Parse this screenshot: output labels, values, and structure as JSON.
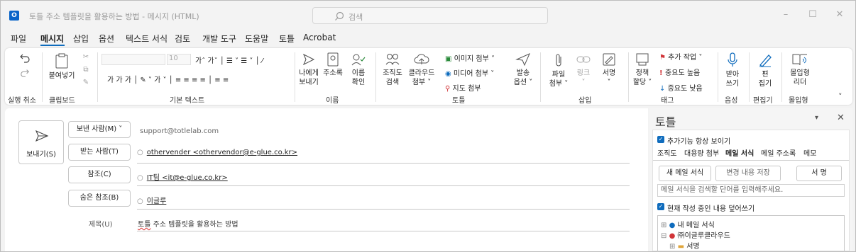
{
  "window": {
    "title": "토틀 주소 템플릿을 활용하는 방법 - 메시지 (HTML)",
    "search_placeholder": "검색",
    "app_icon": "outlook-icon",
    "minimize": "–",
    "maximize": "☐",
    "close": "✕"
  },
  "menu": {
    "tabs": [
      "파일",
      "메시지",
      "삽입",
      "옵션",
      "텍스트 서식",
      "검토",
      "개발 도구",
      "도움말",
      "토틀",
      "Acrobat"
    ],
    "active": "메시지"
  },
  "ribbon": {
    "undo": {
      "group": "실행 취소"
    },
    "clipboard": {
      "paste": "붙여넣기",
      "group": "클립보드"
    },
    "basic_text": {
      "font_size": "10",
      "group": "기본 텍스트"
    },
    "names": {
      "address_book": "주소록",
      "to_me_1": "나에게",
      "to_me_2": "보내기",
      "check_1": "이름",
      "check_2": "확인",
      "group": "이름"
    },
    "totle": {
      "org_1": "조직도",
      "org_2": "검색",
      "cloud_1": "클라우드",
      "cloud_2": "첨부 ˅",
      "image_attach": "이미지 첨부 ˅",
      "media_attach": "미디어 첨부 ˅",
      "map_attach": "지도 첨부",
      "send_opt_1": "발송",
      "send_opt_2": "옵션 ˅",
      "group": "토틀"
    },
    "insert": {
      "file_1": "파일",
      "file_2": "첨부 ˅",
      "link_1": "링크",
      "link_2": "˅",
      "sig_1": "서명",
      "sig_2": "˅",
      "group": "삽입"
    },
    "tags": {
      "policy_1": "정책",
      "policy_2": "할당 ˅",
      "follow_up": "추가 작업 ˅",
      "high": "중요도 높음",
      "low": "중요도 낮음",
      "group": "태그"
    },
    "voice": {
      "dictate_1": "받아",
      "dictate_2": "쓰기",
      "group": "음성"
    },
    "editor": {
      "label_1": "편",
      "label_2": "집기",
      "group": "편집기"
    },
    "immersive": {
      "label_1": "몰입형",
      "label_2": "리더",
      "group": "몰입형"
    }
  },
  "compose": {
    "send_label": "보내기(S)",
    "from_label": "보낸 사람(M) ˅",
    "from_address": "support@totlelab.com",
    "to_label": "받는 사람(T)",
    "to_value": "othervender <othervendor@e-glue.co.kr>",
    "cc_label": "참조(C)",
    "cc_value": "IT팀 <it@e-glue.co.kr>",
    "bcc_label": "숨은 참조(B)",
    "bcc_value": "이글루",
    "subject_label": "제목(U)",
    "subject_value_1": "토틀",
    "subject_value_2": " 주소 템플릿을 활용하는 방법"
  },
  "pane": {
    "title": "토틀",
    "dropdown": "▾",
    "close": "✕",
    "always_show": "추가기능 항상 보이기",
    "tabs": [
      "조직도",
      "대용량 첨부",
      "메일 서식",
      "메일 주소록",
      "메모"
    ],
    "active_tab": "메일 서식",
    "new_template": "새 메일 서식",
    "save_changes": "변경 내용 저장",
    "signature": "서 명",
    "search_placeholder": "메일 서식을 검색할 단어를 입력해주세요.",
    "overwrite": "현재 작성 중인 내용 덮어쓰기",
    "tree": [
      "내 메일 서식",
      "㈜이글루클라우드",
      "서명"
    ]
  },
  "colors": {
    "accent": "#0f6cbd",
    "flag": "#d13438"
  }
}
